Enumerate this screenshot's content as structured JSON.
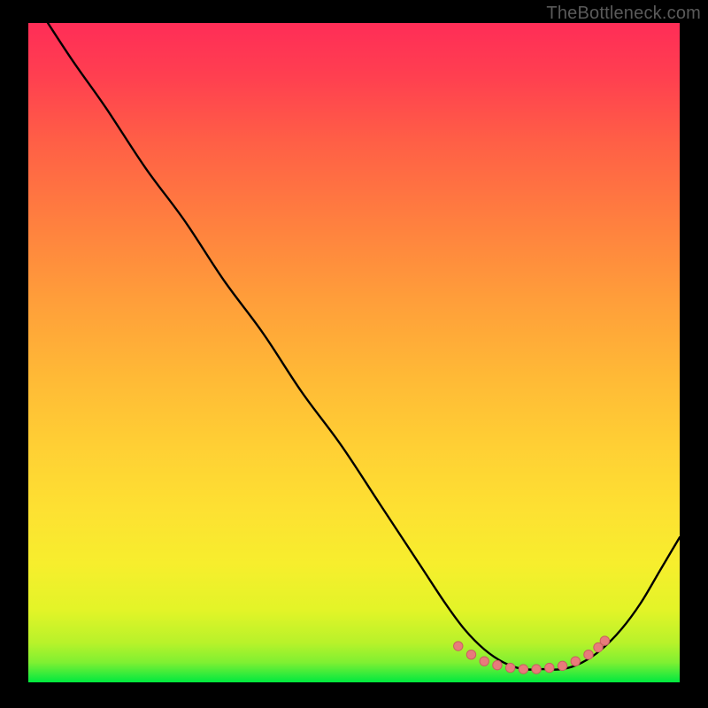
{
  "domain": "Chart",
  "watermark": "TheBottleneck.com",
  "colors": {
    "page_bg": "#000000",
    "gradient_top": "#ff2d57",
    "gradient_mid_upper": "#ff9e3a",
    "gradient_mid": "#fde132",
    "gradient_bottom": "#00e93e",
    "curve": "#000000",
    "marker_fill": "#e87b7b",
    "marker_stroke": "#c96060",
    "watermark_text": "#5a5a5a"
  },
  "chart_data": {
    "type": "line",
    "title": "",
    "xlabel": "",
    "ylabel": "",
    "xlim": [
      0,
      100
    ],
    "ylim": [
      0,
      100
    ],
    "grid": false,
    "legend": false,
    "series": [
      {
        "name": "bottleneck-curve",
        "x": [
          3,
          7,
          12,
          18,
          24,
          30,
          36,
          42,
          48,
          54,
          60,
          64,
          67,
          70,
          73,
          76,
          79,
          82,
          85,
          88,
          91,
          94,
          97,
          100
        ],
        "y": [
          100,
          94,
          87,
          78,
          70,
          61,
          53,
          44,
          36,
          27,
          18,
          12,
          8,
          5,
          3,
          2,
          2,
          2,
          3,
          5,
          8,
          12,
          17,
          22
        ]
      }
    ],
    "markers": {
      "name": "highlight-region",
      "color": "#e87b7b",
      "points": [
        {
          "x": 66,
          "y": 5.5
        },
        {
          "x": 68,
          "y": 4.2
        },
        {
          "x": 70,
          "y": 3.2
        },
        {
          "x": 72,
          "y": 2.6
        },
        {
          "x": 74,
          "y": 2.2
        },
        {
          "x": 76,
          "y": 2.0
        },
        {
          "x": 78,
          "y": 2.0
        },
        {
          "x": 80,
          "y": 2.2
        },
        {
          "x": 82,
          "y": 2.5
        },
        {
          "x": 84,
          "y": 3.2
        },
        {
          "x": 86,
          "y": 4.2
        },
        {
          "x": 87.5,
          "y": 5.3
        },
        {
          "x": 88.5,
          "y": 6.3
        }
      ]
    }
  }
}
